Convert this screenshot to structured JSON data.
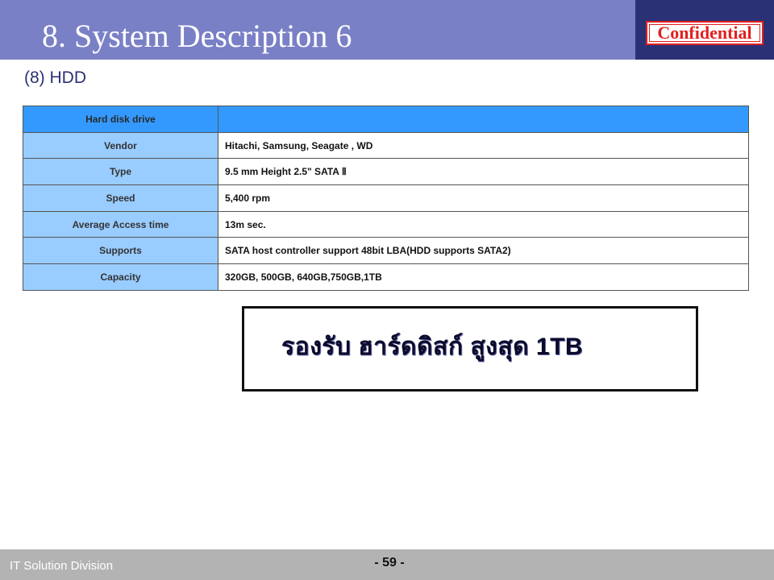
{
  "header": {
    "title": "8. System Description 6",
    "badge": "Confidential"
  },
  "section": {
    "subtitle": "(8) HDD"
  },
  "table": {
    "rows": [
      {
        "label": "Hard disk drive",
        "value": ""
      },
      {
        "label": "Vendor",
        "value": "Hitachi, Samsung,  Seagate , WD"
      },
      {
        "label": "Type",
        "value": "9.5 mm Height 2.5\"  SATA  Ⅱ"
      },
      {
        "label": "Speed",
        "value": "5,400 rpm"
      },
      {
        "label": "Average Access time",
        "value": "13m sec."
      },
      {
        "label": "Supports",
        "value": "SATA host controller support 48bit LBA(HDD supports SATA2)"
      },
      {
        "label": "Capacity",
        "value": " 320GB, 500GB, 640GB,750GB,1TB"
      }
    ]
  },
  "note": {
    "text": "รองรับ ฮาร์ดดิสก์ สูงสุด 1TB"
  },
  "footer": {
    "division": "IT Solution Division",
    "page": "- 59 -"
  },
  "colors": {
    "header_bar": "#7a80c6",
    "header_dark": "#2b3175",
    "table_head": "#3399ff",
    "table_label": "#99ccff",
    "confidential": "#e02020"
  }
}
